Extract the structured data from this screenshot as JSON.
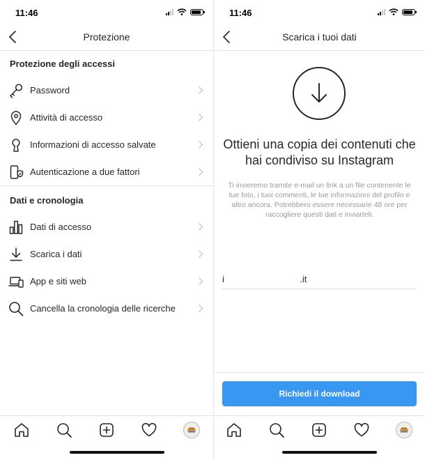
{
  "left_screen": {
    "status": {
      "time": "11:46"
    },
    "title": "Protezione",
    "sections": [
      {
        "title": "Protezione degli accessi",
        "items": [
          {
            "label": "Password",
            "icon": "key-icon"
          },
          {
            "label": "Attività di accesso",
            "icon": "location-pin-icon"
          },
          {
            "label": "Informazioni di accesso salvate",
            "icon": "keyhole-icon"
          },
          {
            "label": "Autenticazione a due fattori",
            "icon": "phone-shield-icon"
          }
        ]
      },
      {
        "title": "Dati e cronologia",
        "items": [
          {
            "label": "Dati di accesso",
            "icon": "bar-chart-icon"
          },
          {
            "label": "Scarica i dati",
            "icon": "download-icon"
          },
          {
            "label": "App e siti web",
            "icon": "devices-icon"
          },
          {
            "label": "Cancella la cronologia delle ricerche",
            "icon": "search-icon"
          }
        ]
      }
    ],
    "tabbar": [
      "home-icon",
      "search-icon",
      "add-post-icon",
      "heart-icon",
      "avatar"
    ]
  },
  "right_screen": {
    "status": {
      "time": "11:46"
    },
    "title": "Scarica i tuoi dati",
    "headline": "Ottieni una copia dei contenuti che hai condiviso su Instagram",
    "description": "Ti invieremo tramite e-mail un link a un file contenente le tue foto, i tuoi commenti, le tue informazioni del profilo e altro ancora. Potrebbero essere necessarie 48 ore per raccogliere questi dati e inviarteli.",
    "email_value": "i                              .it",
    "button_label": "Richiedi il download",
    "tabbar": [
      "home-icon",
      "search-icon",
      "add-post-icon",
      "heart-icon",
      "avatar"
    ]
  },
  "colors": {
    "accent_button": "#3897f0",
    "text": "#262626",
    "muted_text": "#9a9a9a",
    "divider": "#e3e3e3"
  }
}
